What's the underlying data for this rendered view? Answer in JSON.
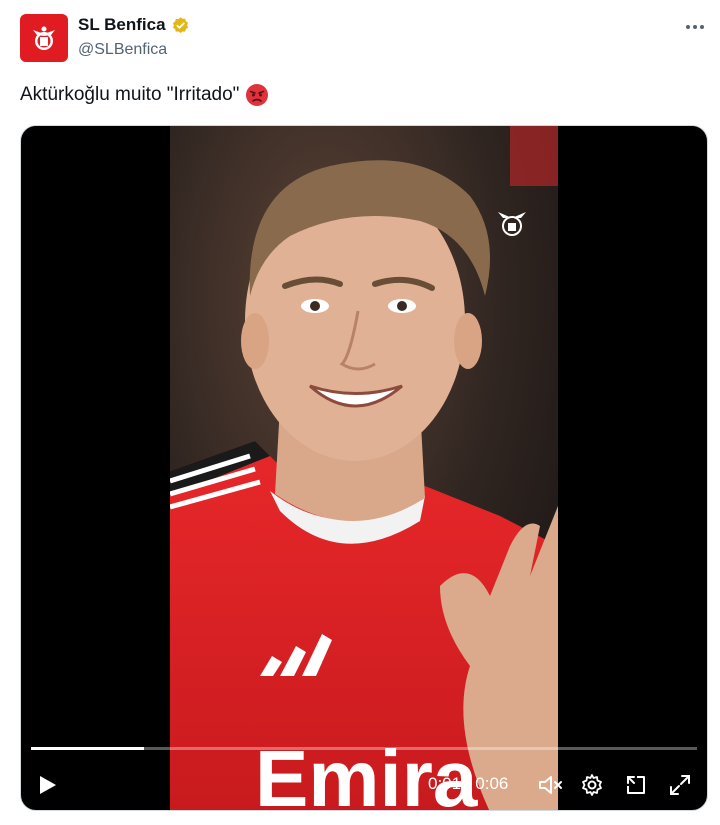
{
  "author": {
    "display_name": "SL Benfica",
    "handle": "@SLBenfica",
    "verified": true,
    "avatar_icon": "benfica-crest-icon",
    "brand_color": "#e11b22",
    "verified_color": "#e2b719"
  },
  "tweet": {
    "text": "Aktürkoğlu muito \"Irritado\"",
    "emoji_icon": "angry-face-emoji"
  },
  "video": {
    "jersey_sponsor_text": "Emira",
    "current_time": "0:01",
    "separator": "/",
    "duration": "0:06",
    "progress_fraction": 0.17,
    "muted": true,
    "icons": {
      "play": "play-icon",
      "mute": "volume-muted-icon",
      "settings": "gear-icon",
      "popout": "popout-icon",
      "fullscreen": "fullscreen-icon"
    }
  }
}
